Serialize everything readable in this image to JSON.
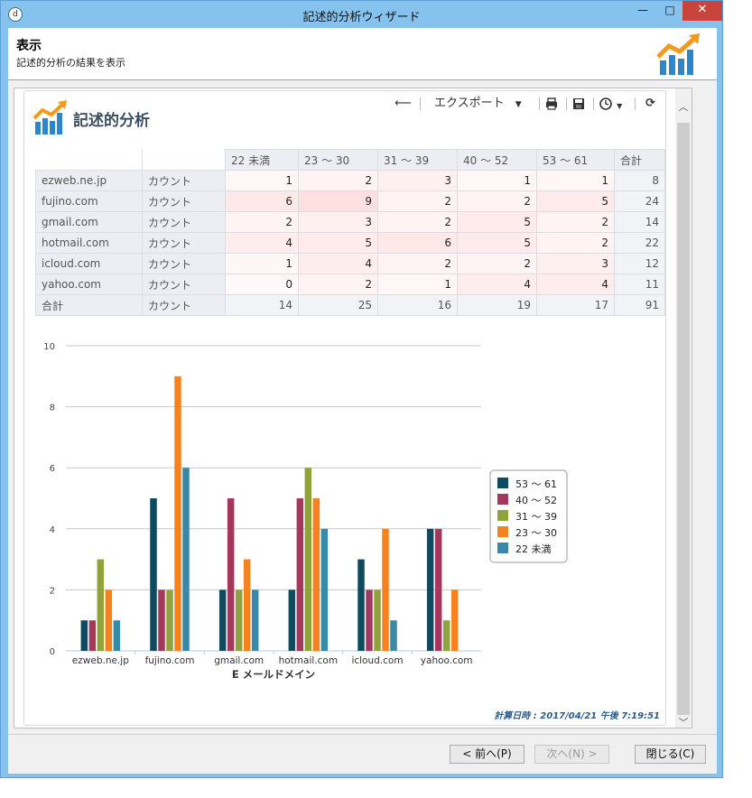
{
  "window": {
    "title": "記述的分析ウィザード",
    "app_icon_glyph": "d"
  },
  "header": {
    "title": "表示",
    "subtitle": "記述的分析の結果を表示"
  },
  "panel": {
    "title": "記述的分析"
  },
  "toolbar": {
    "export_label": "エクスポート",
    "icons": [
      "back-arrow-icon",
      "print-icon",
      "save-icon",
      "clock-icon",
      "refresh-icon"
    ]
  },
  "table": {
    "columns": [
      "22 未満",
      "23 ～ 30",
      "31 ～ 39",
      "40 ～ 52",
      "53 ～ 61",
      "合計"
    ],
    "rows": [
      {
        "label": "ezweb.ne.jp",
        "measure": "カウント",
        "values": [
          1,
          2,
          3,
          1,
          1
        ],
        "total": 8
      },
      {
        "label": "fujino.com",
        "measure": "カウント",
        "values": [
          6,
          9,
          2,
          2,
          5
        ],
        "total": 24
      },
      {
        "label": "gmail.com",
        "measure": "カウント",
        "values": [
          2,
          3,
          2,
          5,
          2
        ],
        "total": 14
      },
      {
        "label": "hotmail.com",
        "measure": "カウント",
        "values": [
          4,
          5,
          6,
          5,
          2
        ],
        "total": 22
      },
      {
        "label": "icloud.com",
        "measure": "カウント",
        "values": [
          1,
          4,
          2,
          2,
          3
        ],
        "total": 12
      },
      {
        "label": "yahoo.com",
        "measure": "カウント",
        "values": [
          0,
          2,
          1,
          4,
          4
        ],
        "total": 11
      }
    ],
    "total_row": {
      "label": "合計",
      "measure": "カウント",
      "values": [
        14,
        25,
        16,
        19,
        17
      ],
      "total": 91
    }
  },
  "chart_data": {
    "type": "bar",
    "categories": [
      "ezweb.ne.jp",
      "fujino.com",
      "gmail.com",
      "hotmail.com",
      "icloud.com",
      "yahoo.com"
    ],
    "series": [
      {
        "name": "53 ～ 61",
        "color": "#0e4a60",
        "values": [
          1,
          5,
          2,
          2,
          3,
          4
        ]
      },
      {
        "name": "40 ～ 52",
        "color": "#a3385c",
        "values": [
          1,
          2,
          5,
          5,
          2,
          4
        ]
      },
      {
        "name": "31 ～ 39",
        "color": "#8ea33a",
        "values": [
          3,
          2,
          2,
          6,
          2,
          1
        ]
      },
      {
        "name": "23 ～ 30",
        "color": "#f5821f",
        "values": [
          2,
          9,
          3,
          5,
          4,
          2
        ]
      },
      {
        "name": "22 未満",
        "color": "#3a88a8",
        "values": [
          1,
          6,
          2,
          4,
          1,
          0
        ]
      }
    ],
    "yticks": [
      0,
      2,
      4,
      6,
      8,
      10
    ],
    "ylim": [
      0,
      10
    ],
    "xlabel": "E メールドメイン",
    "ylabel": "",
    "legend": "right",
    "grid": true
  },
  "calc_time": "計算日時 : 2017/04/21 午後 7:19:51",
  "buttons": {
    "prev": "< 前へ(P)",
    "next": "次へ(N) >",
    "close": "閉じる(C)"
  },
  "window_buttons": {
    "min": "—",
    "max": "□",
    "close": "✕"
  }
}
